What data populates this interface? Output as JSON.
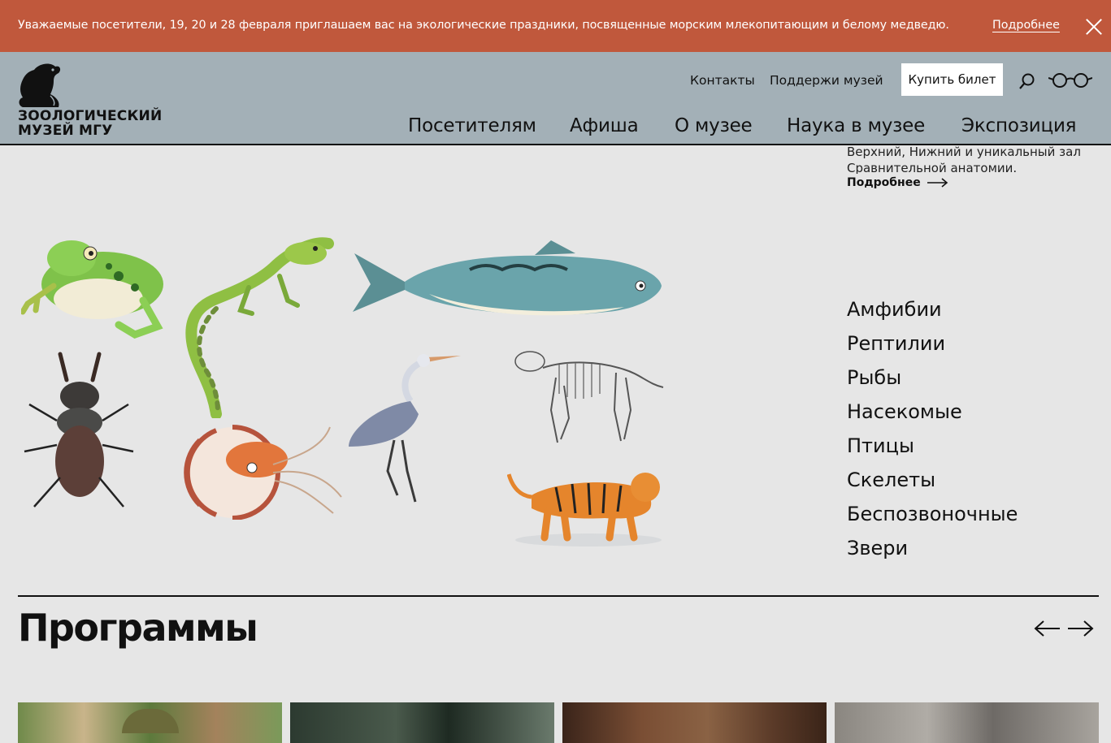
{
  "banner": {
    "text": "Уважаемые посетители, 19, 20 и 28 февраля приглашаем вас на экологические праздники, посвященные морским млекопитающим и белому медведю.",
    "link": "Подробнее",
    "colors": {
      "background": "#c0583c",
      "text": "#ffffff"
    }
  },
  "header": {
    "logo_line1": "ЗООЛОГИЧЕСКИЙ",
    "logo_line2": "МУЗЕЙ МГУ",
    "contacts": "Контакты",
    "support": "Поддержи музей",
    "buy_ticket": "Купить билет",
    "icons": [
      "beaver-logo",
      "search-icon",
      "glasses-icon"
    ],
    "background": "#a3b0b7"
  },
  "nav": [
    "Посетителям",
    "Афиша",
    "О музее",
    "Наука в музее",
    "Экспозиция"
  ],
  "intro": {
    "text": "Верхний, Нижний и уникальный зал Сравнительной анатомии.",
    "more": "Подробнее"
  },
  "categories": [
    "Амфибии",
    "Рептилии",
    "Рыбы",
    "Насекомые",
    "Птицы",
    "Скелеты",
    "Беспозвоночные",
    "Звери"
  ],
  "programs": {
    "title": "Программы",
    "prev_icon": "arrow-left-icon",
    "next_icon": "arrow-right-icon"
  },
  "page_background": "#e6e6e6"
}
